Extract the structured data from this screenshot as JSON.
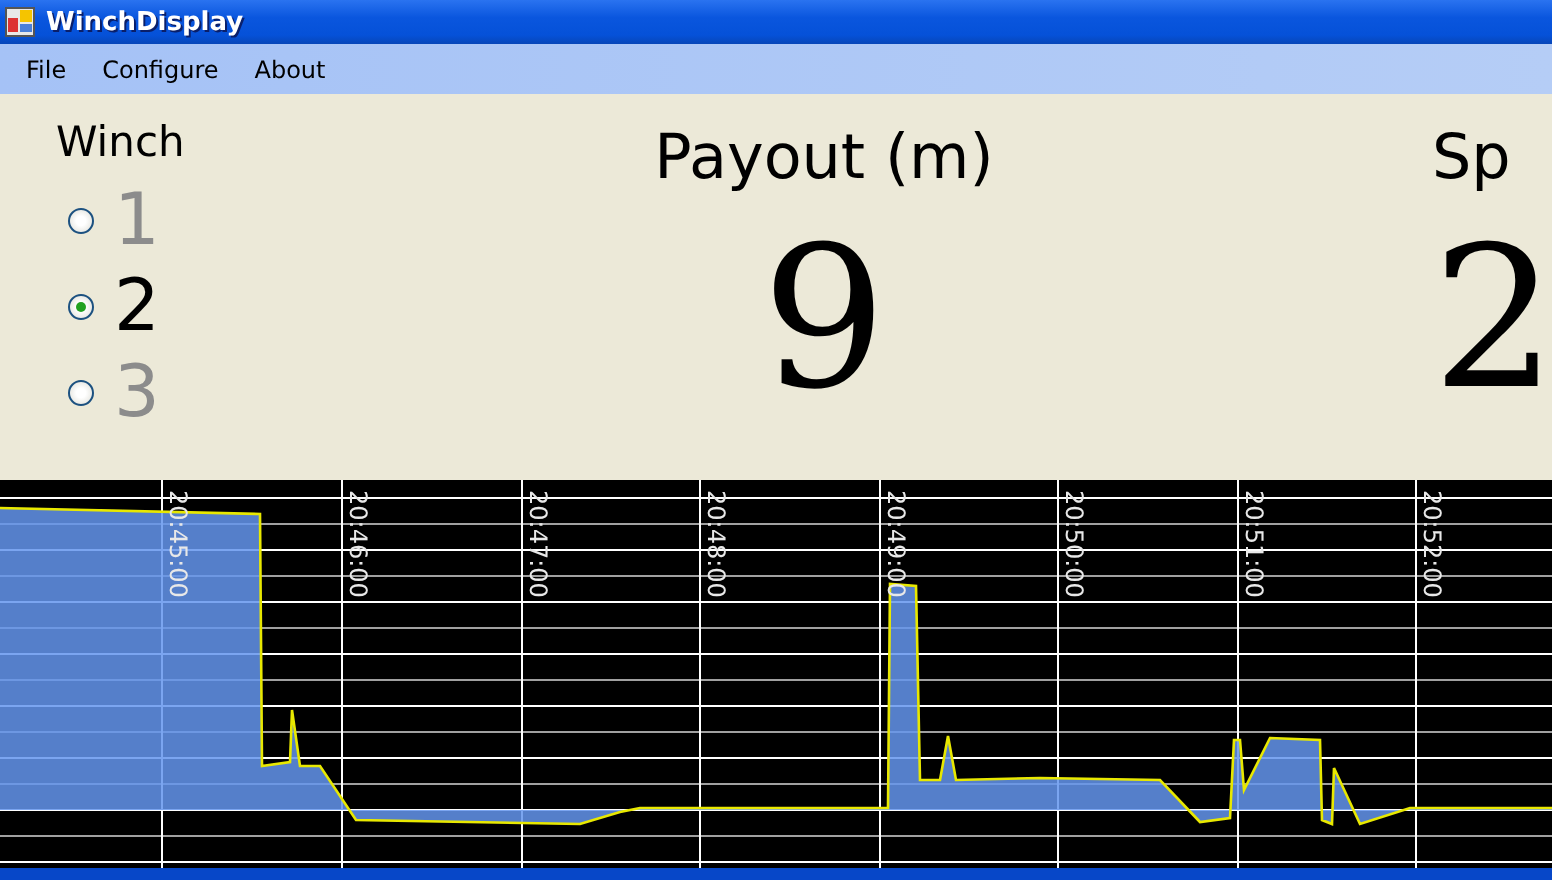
{
  "window": {
    "title": "WinchDisplay"
  },
  "menu": [
    {
      "label": "File"
    },
    {
      "label": "Configure"
    },
    {
      "label": "About"
    }
  ],
  "winch": {
    "label": "Winch",
    "options": [
      {
        "label": "1",
        "selected": false,
        "disabled": true
      },
      {
        "label": "2",
        "selected": true,
        "disabled": false
      },
      {
        "label": "3",
        "selected": false,
        "disabled": true
      }
    ]
  },
  "readouts": [
    {
      "label": "Payout (m)",
      "value": "9"
    },
    {
      "label": "Sp",
      "value": "2"
    }
  ],
  "chart": {
    "time_labels": [
      "20:45:00",
      "20:46:00",
      "20:47:00",
      "20:48:00",
      "20:49:00",
      "20:50:00",
      "20:51:00",
      "20:52:00"
    ]
  }
}
